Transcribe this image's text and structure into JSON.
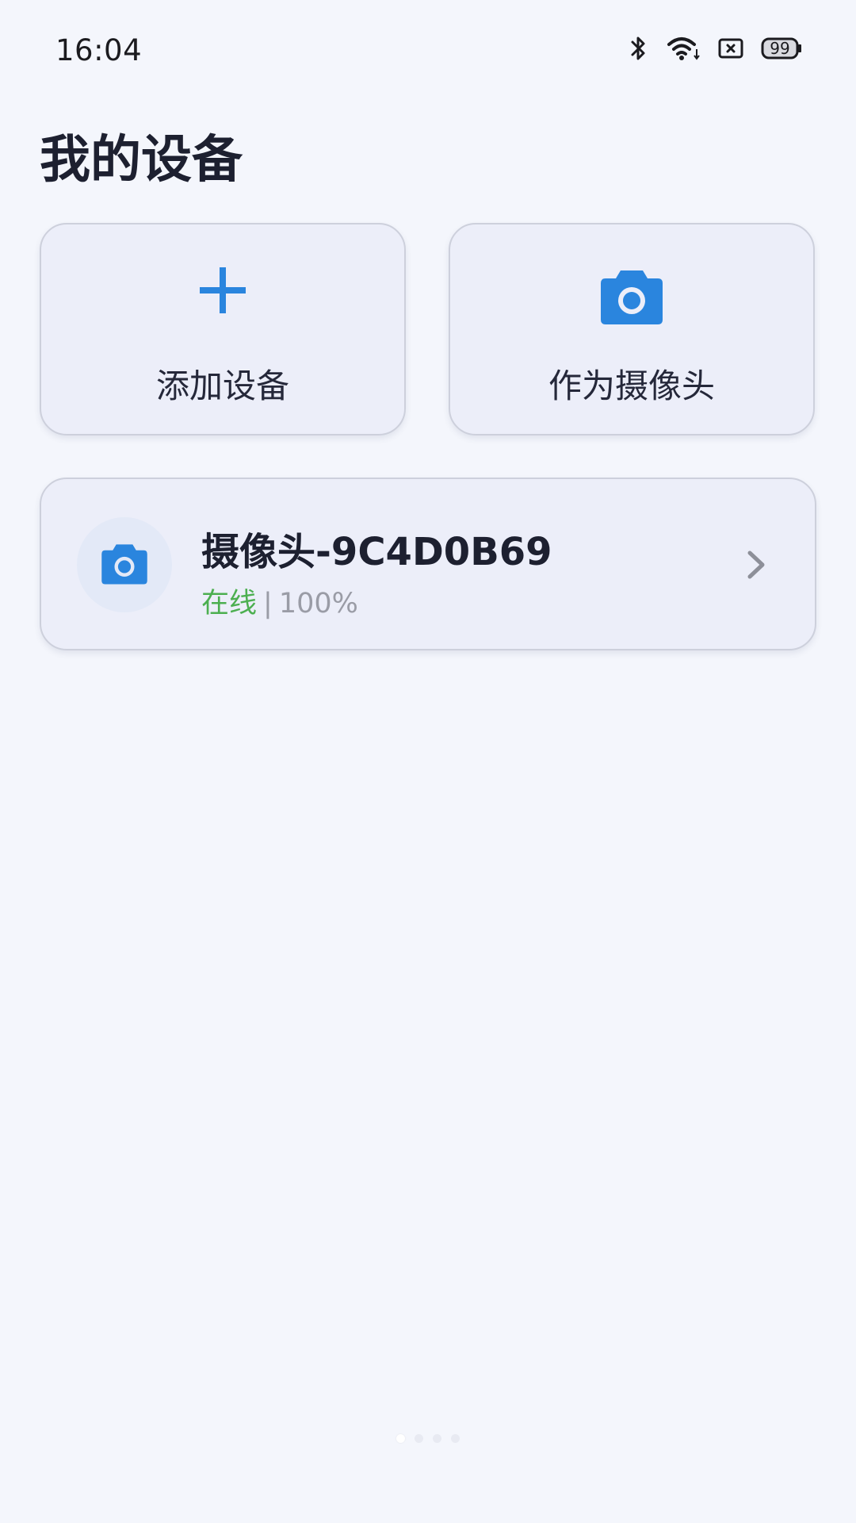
{
  "status_bar": {
    "time": "16:04",
    "battery": "99",
    "icons": [
      "bluetooth-icon",
      "wifi-icon",
      "sim-disabled-icon",
      "battery-icon"
    ]
  },
  "page": {
    "title": "我的设备"
  },
  "actions": {
    "add_device": {
      "label": "添加设备",
      "icon": "plus-icon"
    },
    "as_camera": {
      "label": "作为摄像头",
      "icon": "camera-icon"
    }
  },
  "devices": [
    {
      "name": "摄像头-9C4D0B69",
      "status": "在线",
      "separator": "|",
      "battery": "100%",
      "icon": "camera-icon"
    }
  ],
  "pagination": {
    "total": 4,
    "active": 1
  },
  "colors": {
    "accent": "#2a85de",
    "online": "#4caf50",
    "card_bg": "#eceef9",
    "page_bg": "#f4f6fc"
  }
}
